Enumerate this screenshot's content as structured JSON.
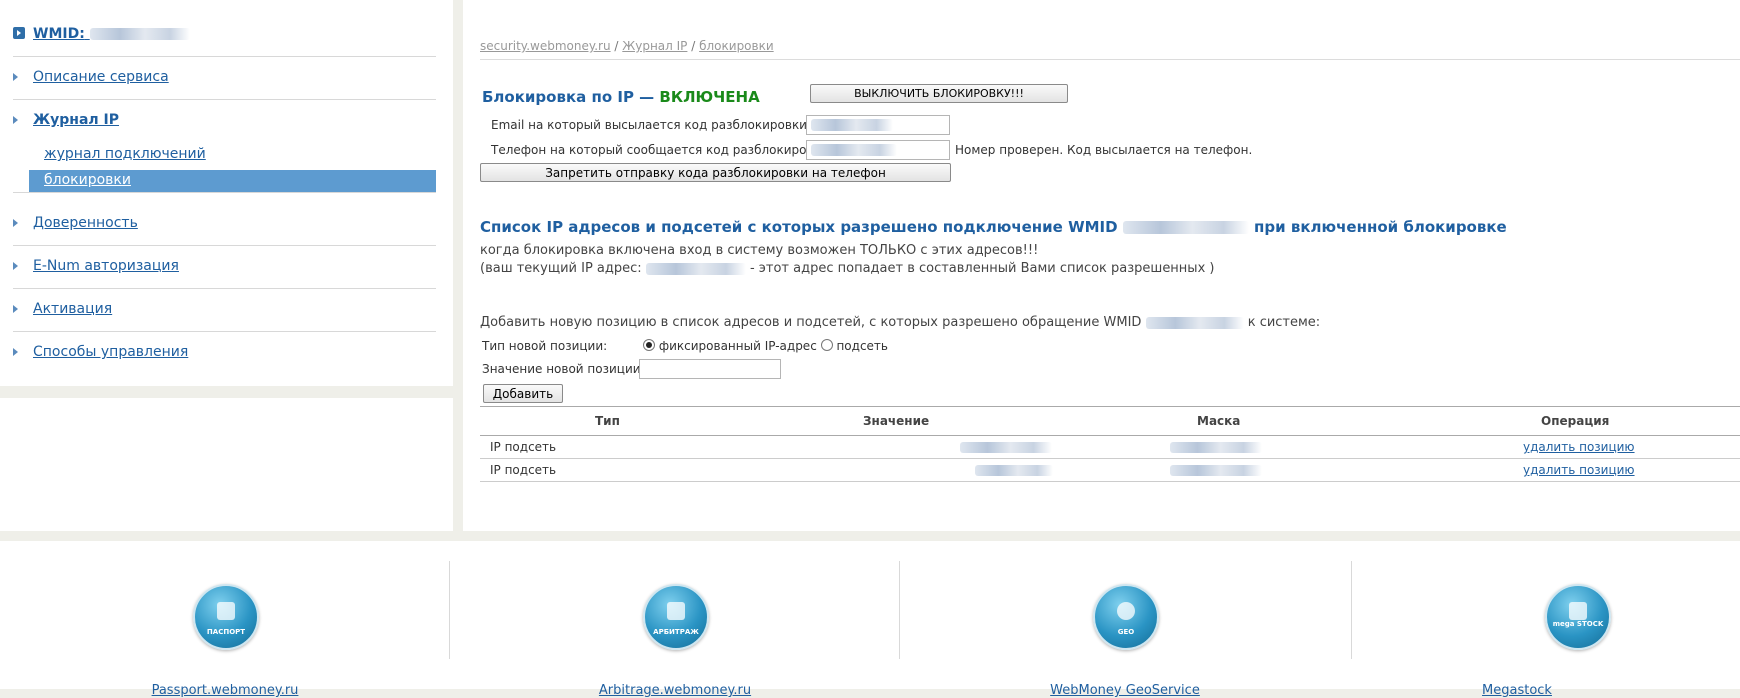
{
  "sidebar": {
    "wmid_label": "WMID:",
    "items": [
      {
        "label": "Описание сервиса"
      },
      {
        "label": "Журнал IP"
      },
      {
        "label": "Доверенность"
      },
      {
        "label": "E-Num авторизация"
      },
      {
        "label": "Активация"
      },
      {
        "label": "Способы управления"
      }
    ],
    "sub_items": [
      {
        "label": "журнал подключений"
      },
      {
        "label": "блокировки"
      }
    ]
  },
  "breadcrumb": {
    "home": "security.webmoney.ru",
    "sep1": "/",
    "journal": "Журнал IP",
    "sep2": "/",
    "current": "блокировки"
  },
  "blocking": {
    "title_prefix": "Блокировка по IP —",
    "status": "ВКЛЮЧЕНА",
    "disable_button": "ВЫКЛЮЧИТЬ БЛОКИРОВКУ!!!",
    "email_label": "Email на который высылается код разблокировки",
    "phone_label": "Телефон на который сообщается код разблокировки",
    "phone_note": "Номер проверен. Код высылается на телефон.",
    "forbid_button": "Запретить отправку кода разблокировки на телефон"
  },
  "ip_list": {
    "heading_part1": "Список IP адресов и подсетей с которых разрешено подключение WMID",
    "heading_part2": "при включенной блокировке",
    "note1": "когда блокировка включена вход в систему возможен ТОЛЬКО с этих адресов!!!",
    "note2_prefix": "(ваш текущий IP адрес:",
    "note2_suffix": "- этот адрес попадает в составленный Вами список разрешенных )"
  },
  "add_form": {
    "intro_prefix": "Добавить новую позицию в список адресов и подсетей, с которых разрешено обращение WMID",
    "intro_suffix": "к системе:",
    "type_label": "Тип новой позиции:",
    "option_fixed": "фиксированный IP-адрес",
    "option_subnet": "подсеть",
    "selected_option": "fixed",
    "value_label": "Значение новой позиции:",
    "value_input": "",
    "add_button": "Добавить"
  },
  "table": {
    "headers": [
      "Тип",
      "Значение",
      "Маска",
      "Операция"
    ],
    "rows": [
      {
        "type": "IP подсеть",
        "action": "удалить позицию"
      },
      {
        "type": "IP подсеть",
        "action": "удалить позицию"
      }
    ]
  },
  "footer": {
    "services": [
      {
        "icon_text": "ПАСПОРТ",
        "icon": "passport-icon",
        "link": "Passport.webmoney.ru"
      },
      {
        "icon_text": "АРБИТРАЖ",
        "icon": "arbitrage-icon",
        "link": "Arbitrage.webmoney.ru"
      },
      {
        "icon_text": "GEO",
        "icon": "geo-icon",
        "link": "WebMoney GeoService"
      },
      {
        "icon_text": "mega STOCK",
        "icon": "megastock-icon",
        "link": "Megastock"
      }
    ]
  },
  "colors": {
    "accent": "#1f5fa0",
    "active_sidebar": "#5d9bd0",
    "status_on": "#1a8a1a",
    "page_bg": "#efefe9"
  }
}
